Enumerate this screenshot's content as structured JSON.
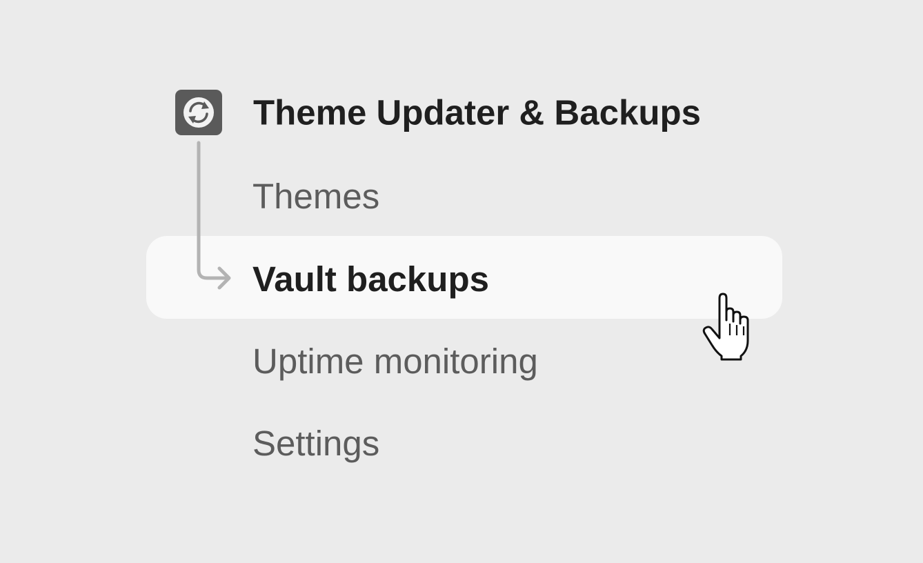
{
  "app": {
    "title": "Theme Updater & Backups",
    "icon": "sync-icon",
    "icon_color": "#5a5a5a"
  },
  "nav": {
    "items": [
      {
        "label": "Themes",
        "active": false
      },
      {
        "label": "Vault backups",
        "active": true
      },
      {
        "label": "Uptime monitoring",
        "active": false
      },
      {
        "label": "Settings",
        "active": false
      }
    ]
  },
  "colors": {
    "background": "#ebebeb",
    "selected_background": "#f9f9f9",
    "text_primary": "#1f1f1f",
    "text_secondary": "#5c5c5c",
    "connector": "#b3b3b3"
  },
  "cursor": "pointer-hand-icon"
}
